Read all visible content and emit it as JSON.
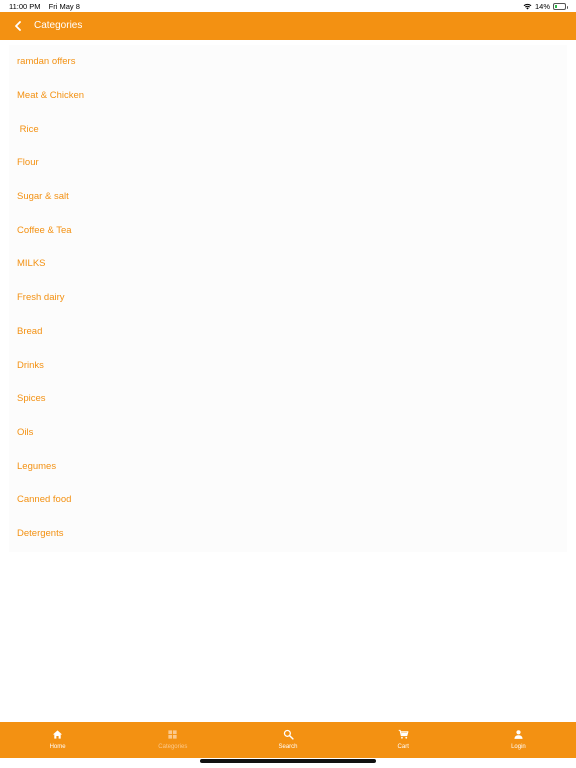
{
  "status_bar": {
    "time": "11:00 PM",
    "date": "Fri May 8",
    "battery": "14%"
  },
  "header": {
    "title": "Categories",
    "background": "#f39112"
  },
  "categories": [
    "ramdan offers",
    "Meat & Chicken",
    " Rice",
    "Flour",
    "Sugar & salt",
    "Coffee & Tea",
    "MILKS",
    "Fresh dairy",
    "Bread",
    "Drinks",
    "Spices",
    "Oils",
    "Legumes",
    "Canned food",
    "Detergents"
  ],
  "bottom_nav": {
    "items": [
      {
        "label": "Home",
        "icon": "home-icon",
        "active": true
      },
      {
        "label": "Categories",
        "icon": "grid-icon",
        "active": false
      },
      {
        "label": "Search",
        "icon": "search-icon",
        "active": true
      },
      {
        "label": "Cart",
        "icon": "cart-icon",
        "active": true
      },
      {
        "label": "Login",
        "icon": "person-icon",
        "active": true
      }
    ]
  },
  "colors": {
    "accent": "#f39112",
    "inactive_nav_label": "#fbc98d"
  }
}
